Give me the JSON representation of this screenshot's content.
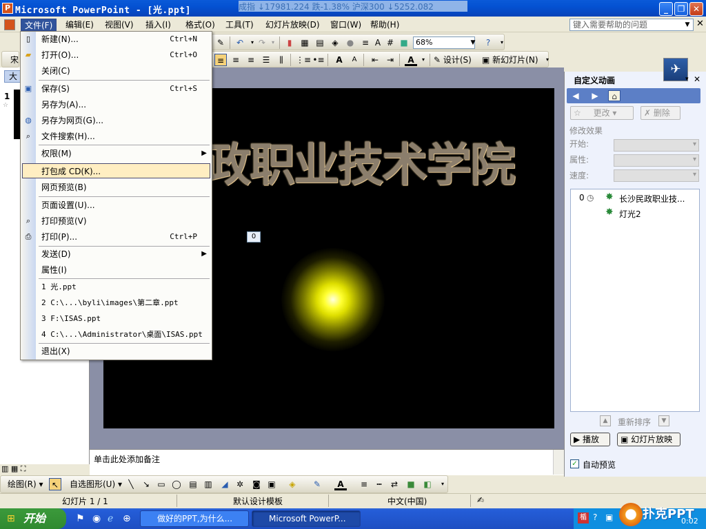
{
  "window": {
    "title": "Microsoft PowerPoint - [光.ppt]",
    "ticker": "成指 ↓17981.224 跌-1.38%   沪深300 ↓5252.082",
    "minimize": "_",
    "restore": "❐",
    "close": "✕"
  },
  "menubar": {
    "items": [
      "文件(F)",
      "编辑(E)",
      "视图(V)",
      "插入(I)",
      "格式(O)",
      "工具(T)",
      "幻灯片放映(D)",
      "窗口(W)",
      "帮助(H)"
    ],
    "help_placeholder": "键入需要帮助的问题"
  },
  "toolbar": {
    "zoom": "68%",
    "font_name": "宋",
    "design_label": "设计(S)",
    "new_slide_label": "新幻灯片(N)"
  },
  "left_panel": {
    "tab_label": "大",
    "slide_number": "1"
  },
  "slide": {
    "title_text": "沙民政职业技术学院",
    "anim_tag": "0"
  },
  "notes": {
    "placeholder": "单击此处添加备注"
  },
  "task_pane": {
    "title": "自定义动画",
    "change_button": "更改",
    "delete_button": "删除",
    "modify_effect": "修改效果",
    "start_label": "开始:",
    "property_label": "属性:",
    "speed_label": "速度:",
    "list": [
      {
        "index": "0",
        "name": "长沙民政职业技..."
      },
      {
        "index": "",
        "name": "灯光2"
      }
    ],
    "reorder_label": "重新排序",
    "play_button": "播放",
    "slideshow_button": "幻灯片放映",
    "autopreview_label": "自动预览"
  },
  "file_menu": {
    "items": [
      {
        "label": "新建(N)...",
        "shortcut": "Ctrl+N"
      },
      {
        "label": "打开(O)...",
        "shortcut": "Ctrl+O"
      },
      {
        "label": "关闭(C)",
        "shortcut": ""
      },
      {
        "label": "保存(S)",
        "shortcut": "Ctrl+S"
      },
      {
        "label": "另存为(A)...",
        "shortcut": ""
      },
      {
        "label": "另存为网页(G)...",
        "shortcut": ""
      },
      {
        "label": "文件搜索(H)...",
        "shortcut": ""
      },
      {
        "label": "权限(M)",
        "shortcut": ""
      },
      {
        "label": "打包成 CD(K)...",
        "shortcut": ""
      },
      {
        "label": "网页预览(B)",
        "shortcut": ""
      },
      {
        "label": "页面设置(U)...",
        "shortcut": ""
      },
      {
        "label": "打印预览(V)",
        "shortcut": ""
      },
      {
        "label": "打印(P)...",
        "shortcut": "Ctrl+P"
      },
      {
        "label": "发送(D)",
        "shortcut": ""
      },
      {
        "label": "属性(I)",
        "shortcut": ""
      },
      {
        "label": "1 光.ppt",
        "shortcut": ""
      },
      {
        "label": "2 C:\\...\\byli\\images\\第二章.ppt",
        "shortcut": ""
      },
      {
        "label": "3 F:\\ISAS.ppt",
        "shortcut": ""
      },
      {
        "label": "4 C:\\...\\Administrator\\桌面\\ISAS.ppt",
        "shortcut": ""
      },
      {
        "label": "退出(X)",
        "shortcut": ""
      }
    ]
  },
  "drawing_toolbar": {
    "draw_label": "绘图(R)",
    "autoshape_label": "自选图形(U)"
  },
  "status": {
    "slide_info": "幻灯片 1 / 1",
    "template": "默认设计模板",
    "language": "中文(中国)"
  },
  "taskbar": {
    "start": "开始",
    "task1": "做好的PPT,为什么...",
    "task2": "Microsoft PowerP...",
    "tray_logo": "扑克PPT",
    "tray_time": "0:02"
  }
}
